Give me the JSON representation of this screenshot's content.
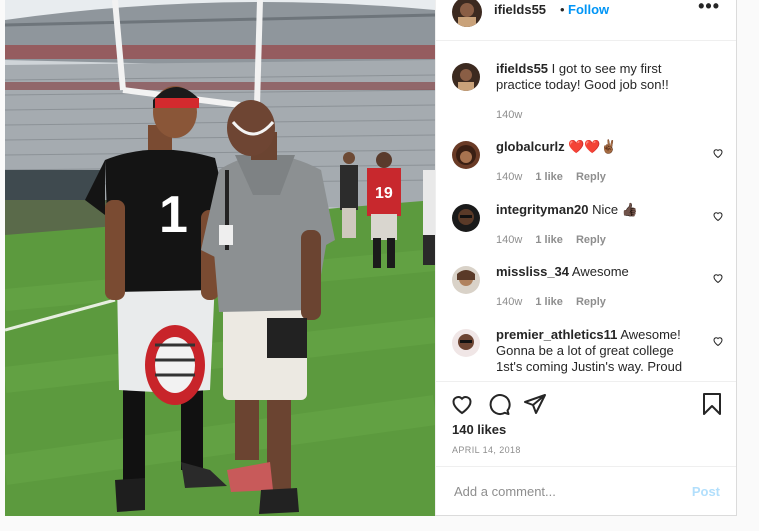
{
  "post": {
    "username": "ifields55",
    "separator": "•",
    "follow_label": "Follow",
    "more_label": "•••",
    "caption": {
      "username": "ifields55",
      "text": "I got to see my first practice today! Good job son!!",
      "time": "140w"
    },
    "comments": [
      {
        "username": "globalcurlz",
        "text": "❤️❤️✌🏾",
        "time": "140w",
        "likes": "1 like",
        "reply": "Reply"
      },
      {
        "username": "integrityman20",
        "text": "Nice 👍🏿",
        "time": "140w",
        "likes": "1 like",
        "reply": "Reply"
      },
      {
        "username": "missliss_34",
        "text": "Awesome",
        "time": "140w",
        "likes": "1 like",
        "reply": "Reply"
      },
      {
        "username": "premier_athletics11",
        "text": "Awesome! Gonna be a lot of great college 1st's coming Justin's way. Proud",
        "time": "",
        "likes": "",
        "reply": ""
      }
    ],
    "likes_label": "140 likes",
    "date": "APRIL 14, 2018",
    "add_comment_placeholder": "Add a comment...",
    "post_button": "Post",
    "jersey_number": "1",
    "jersey_number_back": "19"
  },
  "colors": {
    "follow": "#0095f6",
    "post_disabled": "#b2dffc",
    "muted": "#8e8e8e"
  }
}
